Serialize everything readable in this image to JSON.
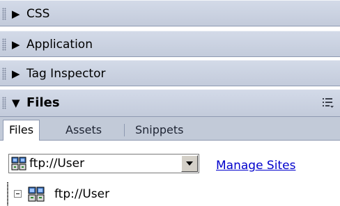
{
  "panels": {
    "css": {
      "title": "CSS",
      "state": "collapsed"
    },
    "application": {
      "title": "Application",
      "state": "collapsed"
    },
    "tag_inspector": {
      "title": "Tag Inspector",
      "state": "collapsed"
    },
    "files": {
      "title": "Files",
      "state": "expanded"
    }
  },
  "tabs": {
    "files": "Files",
    "assets": "Assets",
    "snippets": "Snippets"
  },
  "toolbar": {
    "site_selector_value": "ftp://User",
    "manage_sites_label": "Manage Sites"
  },
  "tree": {
    "root_label": "ftp://User",
    "root_state": "expanded"
  },
  "icons": {
    "panel_grip": "grip-icon",
    "collapsed": "triangle-right-icon",
    "expanded": "triangle-down-icon",
    "options": "panel-options-icon",
    "site": "ftp-site-icon",
    "dropdown": "chevron-down-icon",
    "tree_toggle": "minus-box-icon"
  },
  "colors": {
    "panel_header": "#c8cfdd",
    "tab_bar": "#c2cad8",
    "link": "#0000cc"
  }
}
